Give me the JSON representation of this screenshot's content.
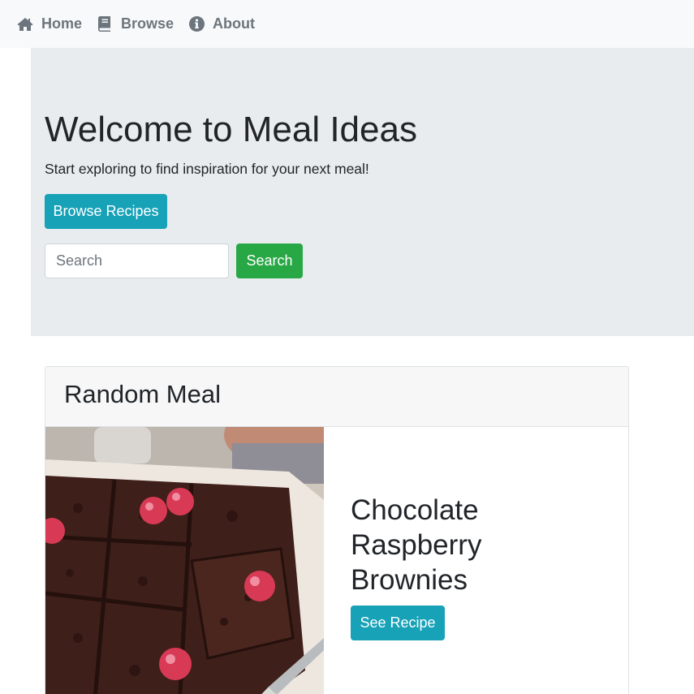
{
  "nav": {
    "items": [
      {
        "label": "Home",
        "icon": "home-icon"
      },
      {
        "label": "Browse",
        "icon": "book-icon"
      },
      {
        "label": "About",
        "icon": "info-circle-icon"
      }
    ]
  },
  "hero": {
    "title": "Welcome to Meal Ideas",
    "lead": "Start exploring to find inspiration for your next meal!",
    "browse_label": "Browse Recipes",
    "search_placeholder": "Search",
    "search_label": "Search"
  },
  "random_meal": {
    "header": "Random Meal",
    "name": "Chocolate Raspberry Brownies",
    "see_recipe_label": "See Recipe"
  },
  "colors": {
    "navbar_bg": "#f8f9fa",
    "nav_text": "#6c757d",
    "jumbotron_bg": "#e9ecef",
    "info_button": "#17a2b8",
    "success_button": "#28a745"
  }
}
